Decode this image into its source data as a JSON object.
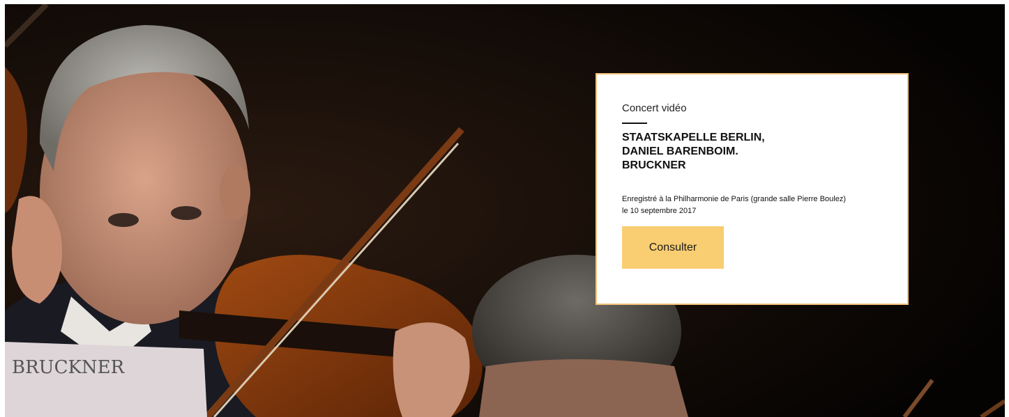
{
  "hero": {
    "image_description_icon": "orchestra-violinist-photo",
    "score_text": "BRUCKNER"
  },
  "card": {
    "kicker": "Concert vidéo",
    "title_lines": [
      "STAATSKAPELLE BERLIN,",
      "DANIEL BARENBOIM.",
      "BRUCKNER"
    ],
    "meta_lines": [
      "Enregistré à la Philharmonie de Paris (grande salle Pierre Boulez)",
      "le 10 septembre 2017"
    ],
    "button_label": "Consulter"
  },
  "colors": {
    "card_border": "#f2c27a",
    "button_bg": "#f9cd71",
    "background": "#0a0604"
  }
}
